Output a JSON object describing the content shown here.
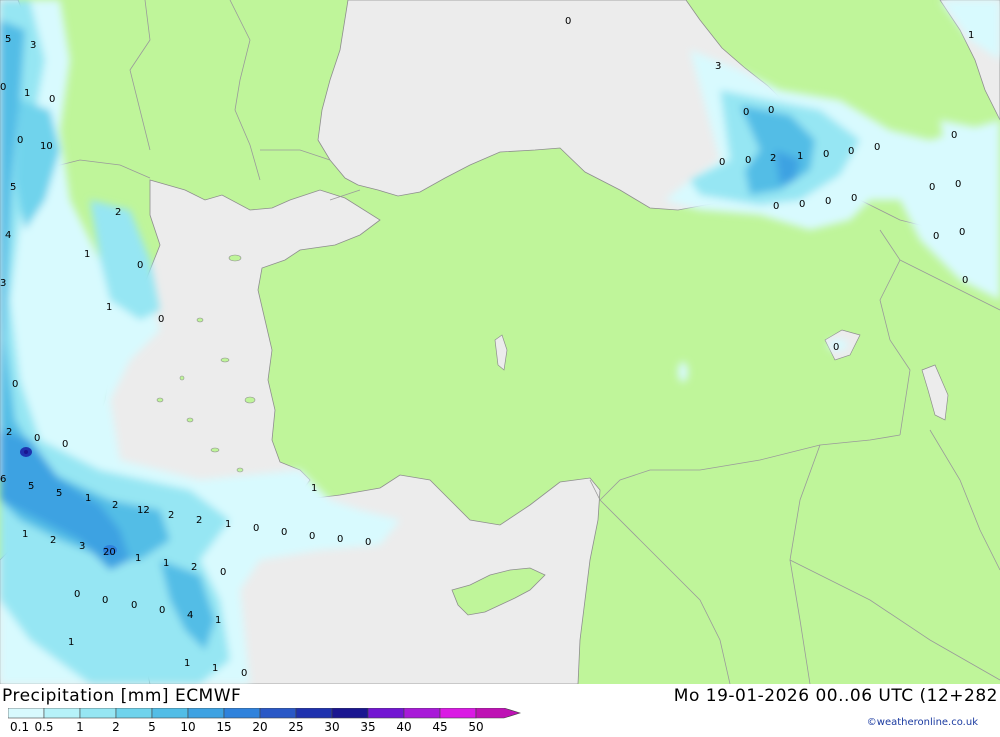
{
  "header": {
    "title": "Precipitation [mm] ECMWF",
    "datetime": "Mo 19-01-2026 00..06 UTC (12+282",
    "credit": "©weatheronline.co.uk"
  },
  "colors": {
    "land": "#bff59a",
    "sea": "#ececec",
    "border": "#9a9a9a",
    "coast": "#8e8e8e"
  },
  "legend": {
    "labels": [
      "0.1",
      "0.5",
      "1",
      "2",
      "5",
      "10",
      "15",
      "20",
      "25",
      "30",
      "35",
      "40",
      "45",
      "50"
    ],
    "colors": [
      "#d8fafe",
      "#b6f2f9",
      "#96e6f3",
      "#6fd3ec",
      "#52bde6",
      "#3ea2e2",
      "#2f82dc",
      "#2a58c6",
      "#1f32ae",
      "#1a1690",
      "#7216d2",
      "#a81ad8",
      "#da1ae4",
      "#be12b4"
    ]
  },
  "map_values": [
    "0",
    "5",
    "3",
    "0",
    "1",
    "0",
    "0",
    "10",
    "5",
    "4",
    "3",
    "0",
    "2",
    "0",
    "0",
    "6",
    "5",
    "5",
    "1",
    "2",
    "12",
    "2",
    "2",
    "1",
    "0",
    "0",
    "0",
    "0",
    "0",
    "1",
    "2",
    "3",
    "20",
    "1",
    "1",
    "2",
    "0",
    "0",
    "0",
    "0",
    "0",
    "4",
    "1",
    "1",
    "1",
    "1",
    "0",
    "2",
    "0",
    "1",
    "1",
    "0",
    "1",
    "3",
    "0",
    "0",
    "0",
    "0",
    "2",
    "1",
    "0",
    "0",
    "0",
    "0",
    "0",
    "0",
    "0",
    "0",
    "0",
    "0",
    "0",
    "0",
    "0",
    "1",
    "0"
  ]
}
